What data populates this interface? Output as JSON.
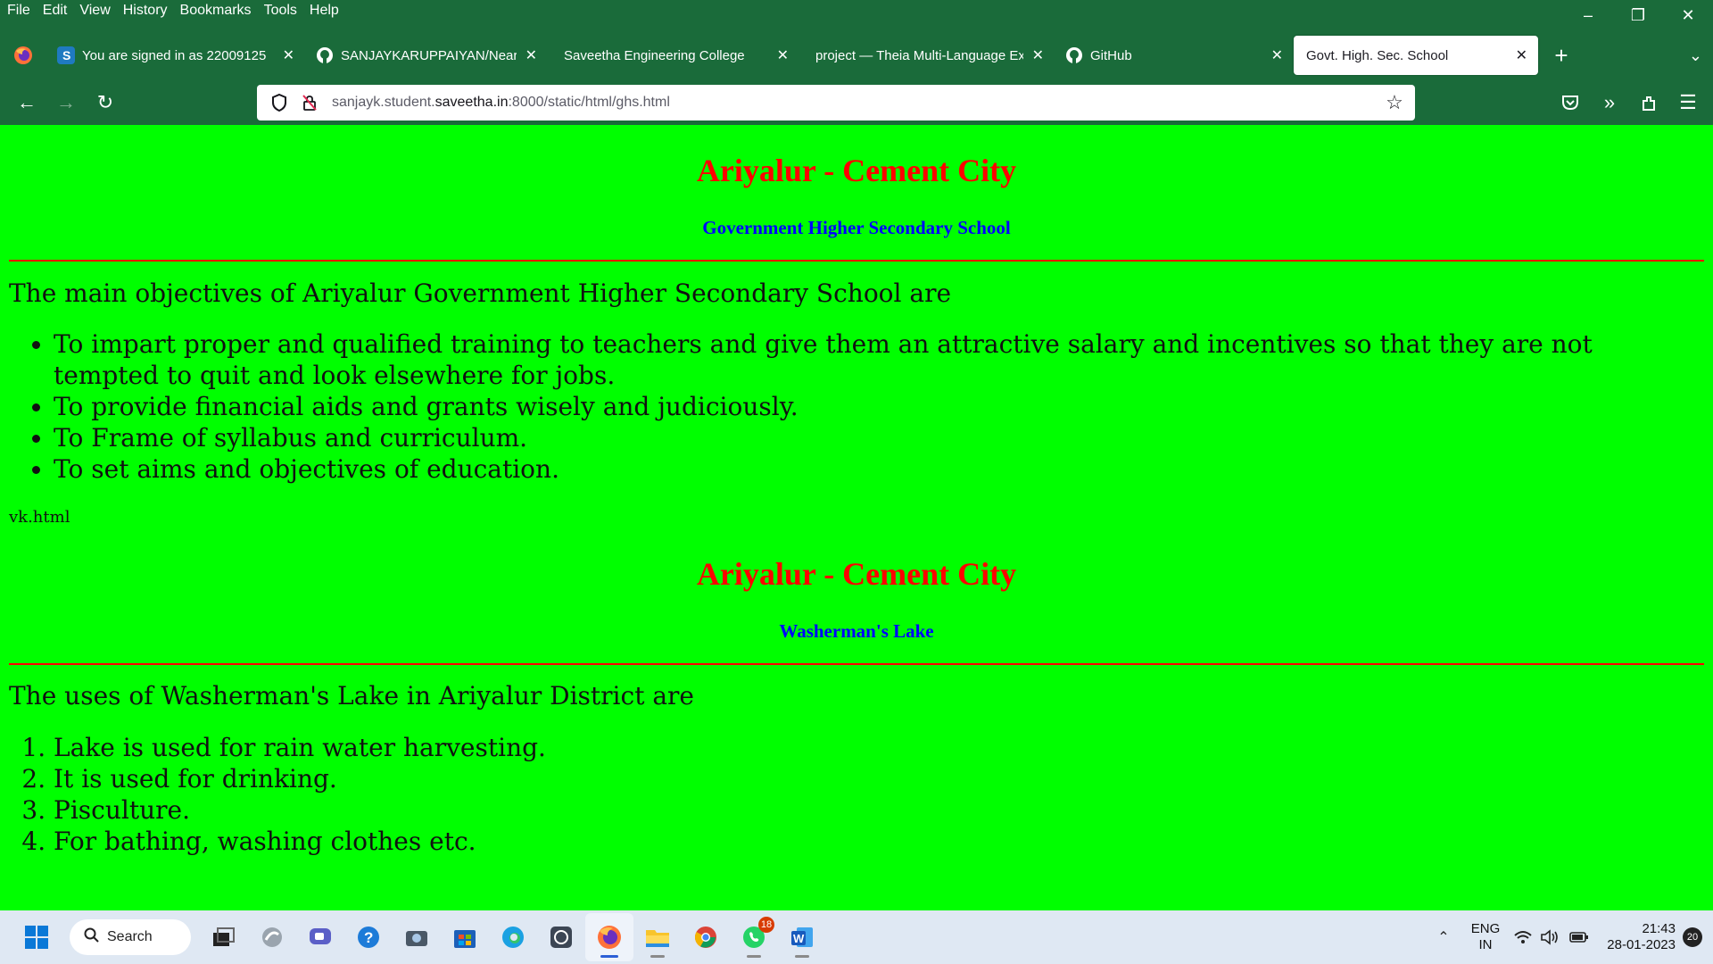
{
  "menu": [
    "File",
    "Edit",
    "View",
    "History",
    "Bookmarks",
    "Tools",
    "Help"
  ],
  "tabs": [
    {
      "title": "You are signed in as 22009125",
      "favicon": "sharepoint-s-icon",
      "active": false
    },
    {
      "title": "SANJAYKARUPPAIYAN/NearMe",
      "favicon": "github-icon",
      "active": false
    },
    {
      "title": "Saveetha Engineering College",
      "favicon": "",
      "active": false
    },
    {
      "title": "project — Theia Multi-Language Ex",
      "favicon": "",
      "active": false
    },
    {
      "title": "GitHub",
      "favicon": "github-icon",
      "active": false
    },
    {
      "title": "Govt. High. Sec. School",
      "favicon": "",
      "active": true
    }
  ],
  "url": {
    "prefix": "sanjayk.student.",
    "domain": "saveetha.in",
    "suffix": ":8000/static/html/ghs.html"
  },
  "page": {
    "section1": {
      "heading": "Ariyalur - Cement City",
      "subheading": "Government Higher Secondary School",
      "intro": "The main objectives of Ariyalur Government Higher Secondary School are",
      "bullets": [
        "To impart proper and qualified training to teachers and give them an attractive salary and incentives so that they are not tempted to quit and look elsewhere for jobs.",
        "To provide financial aids and grants wisely and judiciously.",
        "To Frame of syllabus and curriculum.",
        "To set aims and objectives of education."
      ]
    },
    "broken_link_text": "vk.html",
    "section2": {
      "heading": "Ariyalur - Cement City",
      "subheading": "Washerman's Lake",
      "intro": "The uses of Washerman's Lake in Ariyalur District are",
      "items": [
        "Lake is used for rain water harvesting.",
        "It is used for drinking.",
        "Pisculture.",
        "For bathing, washing clothes etc."
      ]
    }
  },
  "taskbar": {
    "search_label": "Search",
    "whatsapp_badge": "18",
    "lang_top": "ENG",
    "lang_bottom": "IN",
    "time": "21:43",
    "date": "28-01-2023",
    "notif_count": "20"
  },
  "colors": {
    "page_bg": "#00ff00",
    "heading": "#ff0000",
    "subheading": "#0000ff",
    "chrome": "#1a6b3a"
  }
}
